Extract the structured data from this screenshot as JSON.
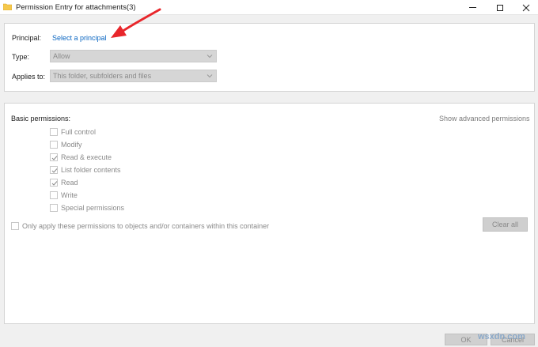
{
  "window": {
    "title": "Permission Entry for attachments(3)"
  },
  "principal": {
    "label": "Principal:",
    "link": "Select a principal"
  },
  "type": {
    "label": "Type:",
    "value": "Allow"
  },
  "applies_to": {
    "label": "Applies to:",
    "value": "This folder, subfolders and files"
  },
  "permissions": {
    "heading": "Basic permissions:",
    "advanced_link": "Show advanced permissions",
    "items": [
      {
        "label": "Full control",
        "checked": false
      },
      {
        "label": "Modify",
        "checked": false
      },
      {
        "label": "Read & execute",
        "checked": true
      },
      {
        "label": "List folder contents",
        "checked": true
      },
      {
        "label": "Read",
        "checked": true
      },
      {
        "label": "Write",
        "checked": false
      },
      {
        "label": "Special permissions",
        "checked": false
      }
    ],
    "only_apply": "Only apply these permissions to objects and/or containers within this container",
    "clear_all": "Clear all"
  },
  "footer": {
    "ok": "OK",
    "cancel": "Cancel"
  },
  "watermark": "wsxdn.com",
  "colors": {
    "link": "#0a66c2",
    "arrow": "#e8262b",
    "panel_bg": "#ffffff",
    "window_bg": "#f0f0f0"
  }
}
